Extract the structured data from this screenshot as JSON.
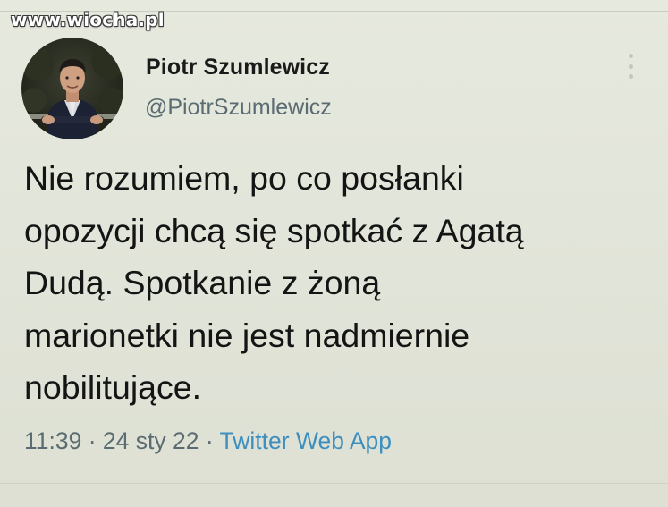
{
  "watermark": {
    "text": "www.wiocha.pl"
  },
  "author": {
    "name": "Piotr Szumlewicz",
    "handle": "@PiotrSzumlewicz"
  },
  "tweet": {
    "lines": [
      "Nie rozumiem, po co posłanki",
      "opozycji chcą się spotkać z Agatą",
      "Dudą. Spotkanie z żoną",
      "marionetki nie jest nadmiernie",
      "nobilitujące."
    ]
  },
  "meta": {
    "time": "11:39",
    "separator": " · ",
    "date": "24 sty 22",
    "source": "Twitter Web App"
  },
  "colors": {
    "background": "#e3e6da",
    "text": "#141414",
    "muted": "#5b6b72",
    "link": "#3d8fbf"
  },
  "icons": {
    "more": "more-vertical-icon"
  }
}
